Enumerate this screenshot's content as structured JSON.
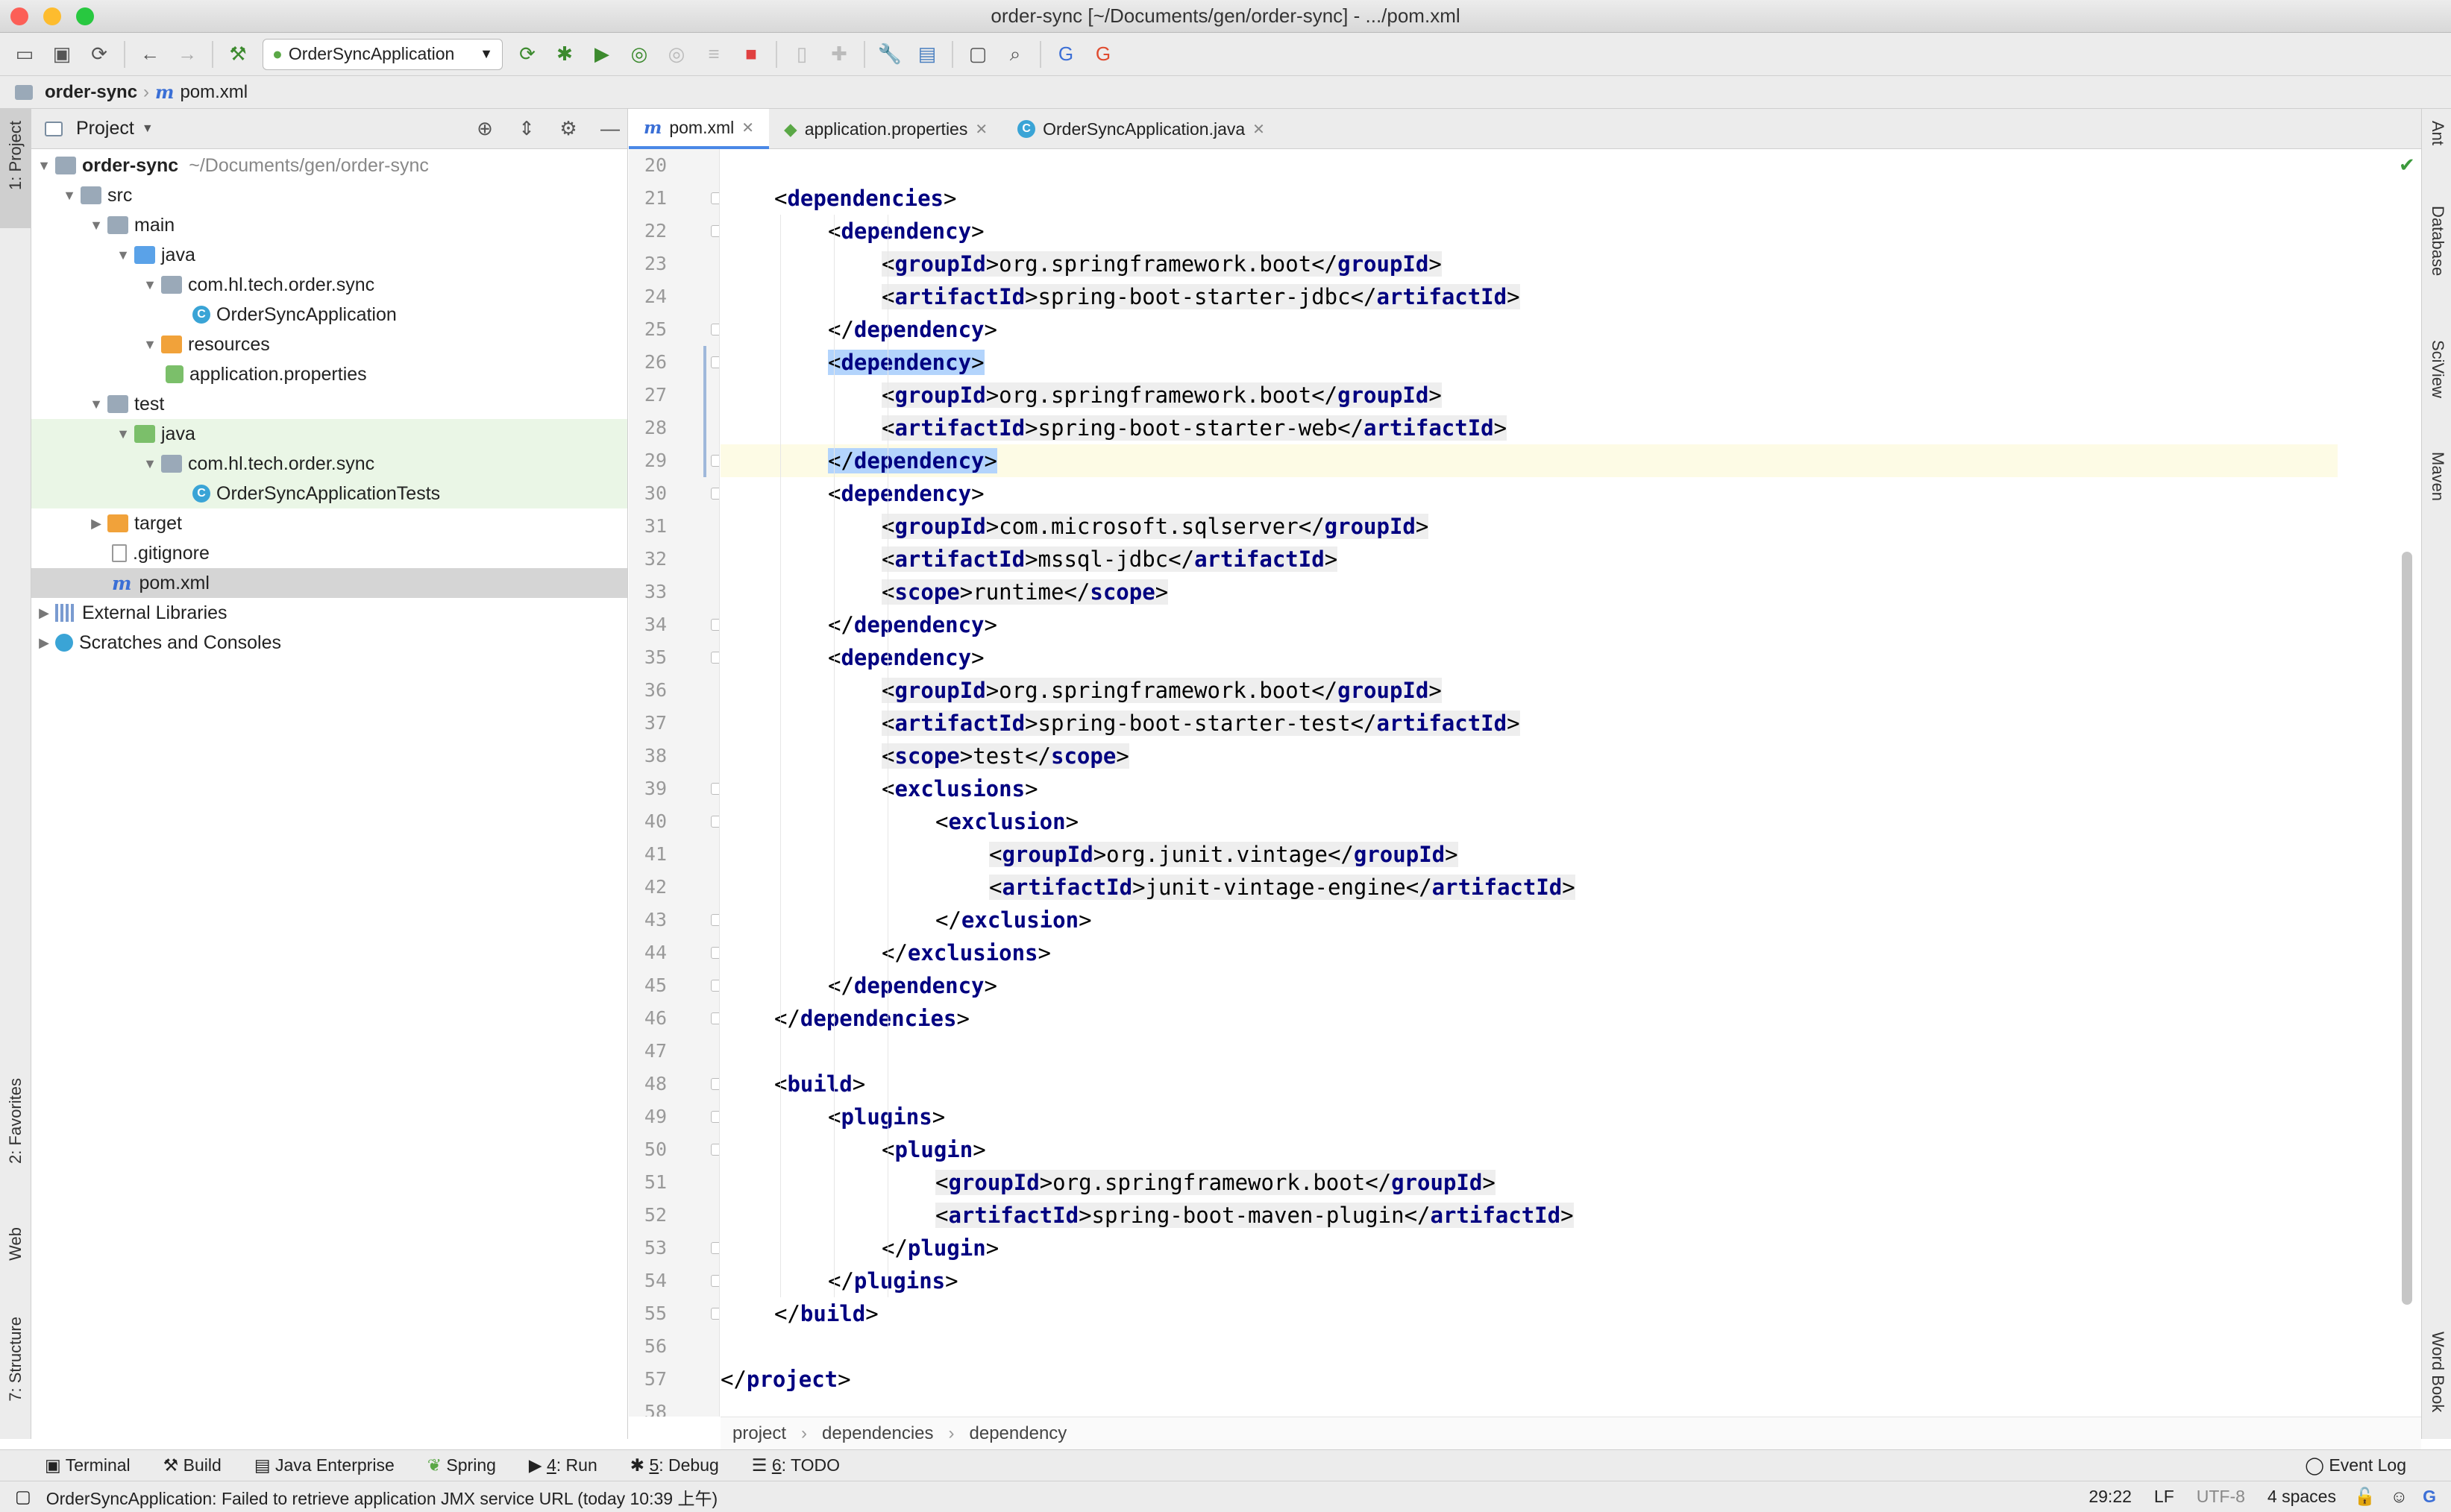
{
  "window": {
    "title": "order-sync [~/Documents/gen/order-sync] - .../pom.xml"
  },
  "toolbar": {
    "run_config": "OrderSyncApplication"
  },
  "navbar": {
    "project": "order-sync",
    "file": "pom.xml"
  },
  "left_strip": {
    "project": "1: Project",
    "favorites": "2: Favorites",
    "web": "Web",
    "structure": "7: Structure"
  },
  "right_strip": {
    "ant": "Ant",
    "database": "Database",
    "sciview": "SciView",
    "maven": "Maven",
    "wordbook": "Word Book"
  },
  "project_panel": {
    "title": "Project",
    "root": {
      "name": "order-sync",
      "path": "~/Documents/gen/order-sync"
    },
    "items": [
      {
        "label": "src"
      },
      {
        "label": "main"
      },
      {
        "label": "java"
      },
      {
        "label": "com.hl.tech.order.sync"
      },
      {
        "label": "OrderSyncApplication"
      },
      {
        "label": "resources"
      },
      {
        "label": "application.properties"
      },
      {
        "label": "test"
      },
      {
        "label": "java"
      },
      {
        "label": "com.hl.tech.order.sync"
      },
      {
        "label": "OrderSyncApplicationTests"
      },
      {
        "label": "target"
      },
      {
        "label": ".gitignore"
      },
      {
        "label": "pom.xml"
      },
      {
        "label": "External Libraries"
      },
      {
        "label": "Scratches and Consoles"
      }
    ]
  },
  "tabs": [
    {
      "label": "pom.xml"
    },
    {
      "label": "application.properties"
    },
    {
      "label": "OrderSyncApplication.java"
    }
  ],
  "editor": {
    "line_numbers": [
      "20",
      "21",
      "22",
      "23",
      "24",
      "25",
      "26",
      "27",
      "28",
      "29",
      "30",
      "31",
      "32",
      "33",
      "34",
      "35",
      "36",
      "37",
      "38",
      "39",
      "40",
      "41",
      "42",
      "43",
      "44",
      "45",
      "46",
      "47",
      "48",
      "49",
      "50",
      "51",
      "52",
      "53",
      "54",
      "55",
      "56",
      "57",
      "58"
    ],
    "lines": [
      {
        "t": ""
      },
      {
        "t": "dependencies"
      },
      {
        "t": "dependency"
      },
      {
        "t": "groupId",
        "v": "org.springframework.boot"
      },
      {
        "t": "artifactId",
        "v": "spring-boot-starter-jdbc"
      },
      {
        "t": "/dependency"
      },
      {
        "t": "dependency"
      },
      {
        "t": "groupId",
        "v": "org.springframework.boot"
      },
      {
        "t": "artifactId",
        "v": "spring-boot-starter-web"
      },
      {
        "t": "/dependency"
      },
      {
        "t": "dependency"
      },
      {
        "t": "groupId",
        "v": "com.microsoft.sqlserver"
      },
      {
        "t": "artifactId",
        "v": "mssql-jdbc"
      },
      {
        "t": "scope",
        "v": "runtime"
      },
      {
        "t": "/dependency"
      },
      {
        "t": "dependency"
      },
      {
        "t": "groupId",
        "v": "org.springframework.boot"
      },
      {
        "t": "artifactId",
        "v": "spring-boot-starter-test"
      },
      {
        "t": "scope",
        "v": "test"
      },
      {
        "t": "exclusions"
      },
      {
        "t": "exclusion"
      },
      {
        "t": "groupId",
        "v": "org.junit.vintage"
      },
      {
        "t": "artifactId",
        "v": "junit-vintage-engine"
      },
      {
        "t": "/exclusion"
      },
      {
        "t": "/exclusions"
      },
      {
        "t": "/dependency"
      },
      {
        "t": "/dependencies"
      },
      {
        "t": ""
      },
      {
        "t": "build"
      },
      {
        "t": "plugins"
      },
      {
        "t": "plugin"
      },
      {
        "t": "groupId",
        "v": "org.springframework.boot"
      },
      {
        "t": "artifactId",
        "v": "spring-boot-maven-plugin"
      },
      {
        "t": "/plugin"
      },
      {
        "t": "/plugins"
      },
      {
        "t": "/build"
      },
      {
        "t": ""
      },
      {
        "t": "/project"
      },
      {
        "t": ""
      }
    ]
  },
  "breadcrumb": [
    "project",
    "dependencies",
    "dependency"
  ],
  "tool_windows": [
    {
      "label": "Terminal"
    },
    {
      "label": "Build"
    },
    {
      "label": "Java Enterprise"
    },
    {
      "label": "Spring"
    },
    {
      "key": "4",
      "label": ": Run"
    },
    {
      "key": "5",
      "label": ": Debug"
    },
    {
      "key": "6",
      "label": ": TODO"
    }
  ],
  "event_log": "Event Log",
  "status": {
    "message": "OrderSyncApplication: Failed to retrieve application JMX service URL (today 10:39 上午)",
    "position": "29:22",
    "line_sep": "LF",
    "encoding": "UTF-8",
    "indent": "4 spaces"
  }
}
